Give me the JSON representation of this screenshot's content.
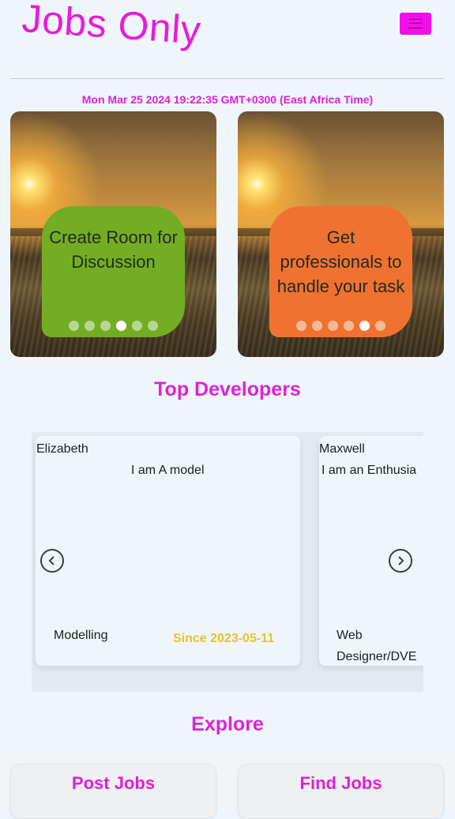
{
  "header": {
    "brand": "Jobs Only",
    "menu_icon": "hamburger-icon"
  },
  "datetime": "Mon Mar 25 2024 19:22:35 GMT+0300 (East Africa Time)",
  "slides": [
    {
      "text": "Create Room for Discussion",
      "color": "#73ad23",
      "dots": 6,
      "active_dot": 4
    },
    {
      "text": "Get professionals to handle your task",
      "color": "#f07230",
      "dots": 6,
      "active_dot": 5
    }
  ],
  "top_developers": {
    "title": "Top Developers",
    "developers": [
      {
        "name": "Elizabeth",
        "bio": "I am A model",
        "skill": "Modelling",
        "since": "Since 2023-05-11"
      },
      {
        "name": "Maxwell",
        "bio": "I am an Enthusia",
        "skill": "Web Designer/DVE",
        "since": ""
      }
    ],
    "prev_icon": "chevron-left-icon",
    "next_icon": "chevron-right-icon"
  },
  "explore": {
    "title": "Explore",
    "buttons": [
      "Post Jobs",
      "Find Jobs"
    ]
  }
}
